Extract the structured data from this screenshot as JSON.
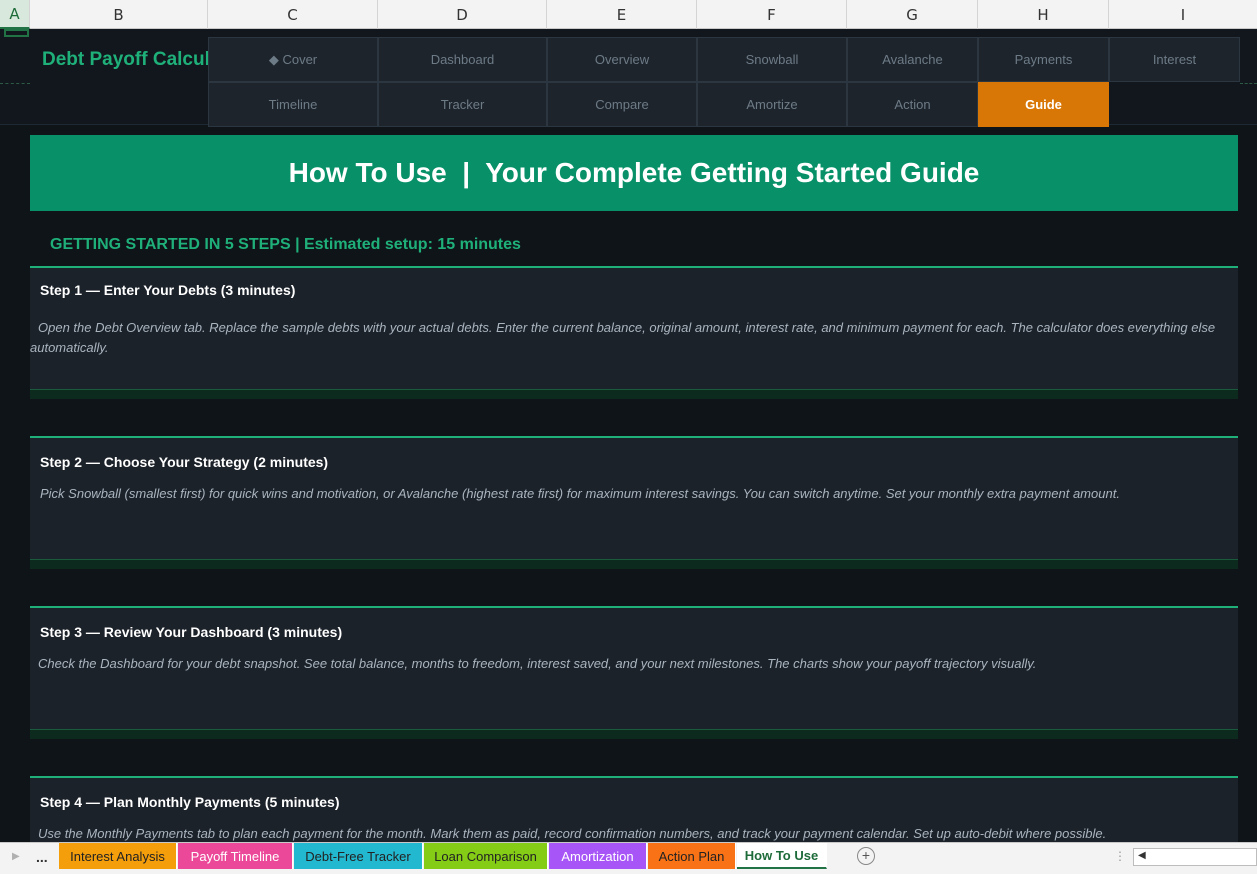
{
  "columns": [
    "A",
    "B",
    "C",
    "D",
    "E",
    "F",
    "G",
    "H",
    "I"
  ],
  "active_column": "A",
  "app_title": "Debt Payoff Calculator",
  "nav_row1": [
    {
      "label": "◆ Cover"
    },
    {
      "label": "Dashboard"
    },
    {
      "label": "Overview"
    },
    {
      "label": "Snowball"
    },
    {
      "label": "Avalanche"
    },
    {
      "label": "Payments"
    },
    {
      "label": "Interest"
    }
  ],
  "nav_row2": [
    {
      "label": "Timeline"
    },
    {
      "label": "Tracker"
    },
    {
      "label": "Compare"
    },
    {
      "label": "Amortize"
    },
    {
      "label": "Action"
    },
    {
      "label": "Guide",
      "active": true
    }
  ],
  "banner": "How To Use  |  Your Complete Getting Started Guide",
  "subheading": "GETTING STARTED IN 5 STEPS  |  Estimated setup: 15 minutes",
  "steps": [
    {
      "title": "Step 1 — Enter Your Debts (3 minutes)",
      "body": "Open the Debt Overview tab. Replace the sample debts with your actual debts. Enter the current balance, original amount, interest rate, and minimum payment for each. The calculator does everything else automatically."
    },
    {
      "title": "Step 2 — Choose Your Strategy (2 minutes)",
      "body": "Pick Snowball (smallest first) for quick wins and motivation, or Avalanche (highest rate first) for maximum interest savings. You can switch anytime. Set your monthly extra payment amount."
    },
    {
      "title": "Step 3 — Review Your Dashboard (3 minutes)",
      "body": "Check the Dashboard for your debt snapshot. See total balance, months to freedom, interest saved, and your next milestones. The charts show your payoff trajectory visually."
    },
    {
      "title": "Step 4 — Plan Monthly Payments (5 minutes)",
      "body": "Use the Monthly Payments tab to plan each payment for the month. Mark them as paid, record confirmation numbers, and track your payment calendar. Set up auto-debit where possible."
    }
  ],
  "sheet_tabs": [
    {
      "label": "Interest Analysis",
      "color": "#f59e0b"
    },
    {
      "label": "Payoff Timeline",
      "color": "#ec4899"
    },
    {
      "label": "Debt-Free Tracker",
      "color": "#22b8cf"
    },
    {
      "label": "Loan Comparison",
      "color": "#84cc16"
    },
    {
      "label": "Amortization",
      "color": "#a855f7"
    },
    {
      "label": "Action Plan",
      "color": "#f97316"
    },
    {
      "label": "How To Use",
      "color": "#ffffff",
      "current": true
    }
  ],
  "tab_overflow": "...",
  "add_sheet_symbol": "+",
  "colors": {
    "accent_green": "#1fb07a",
    "banner_green": "#089168",
    "active_orange": "#d97706",
    "card_bg": "#1c222a",
    "sheet_bg": "#0f1419"
  }
}
